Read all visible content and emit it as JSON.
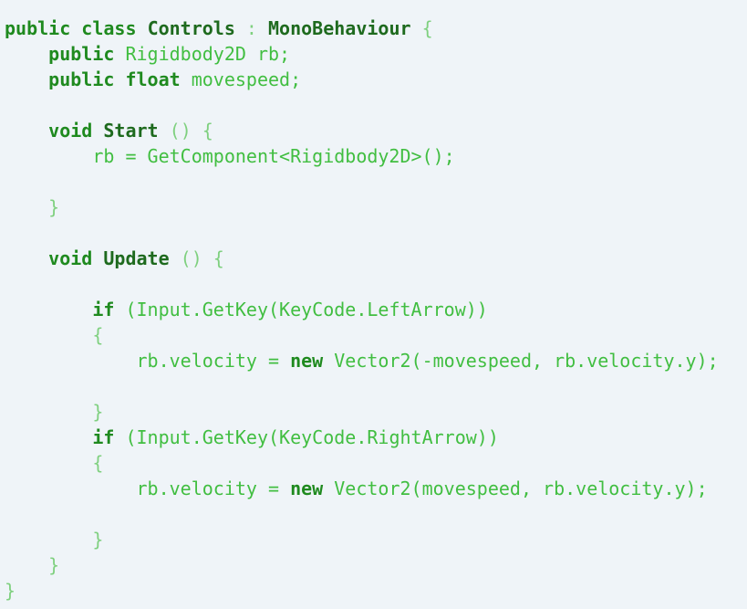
{
  "editor": {
    "language": "csharp",
    "colors": {
      "background": "#eff4f8",
      "keyword": "#1f8a1f",
      "identifier": "#41be41",
      "function_name": "#1e6a1e",
      "punctuation": "#7fd07f"
    },
    "lines": [
      [
        {
          "t": "public",
          "c": "kw"
        },
        {
          "t": " ",
          "c": "pl"
        },
        {
          "t": "class",
          "c": "kw"
        },
        {
          "t": " ",
          "c": "pl"
        },
        {
          "t": "Controls",
          "c": "fn"
        },
        {
          "t": " : ",
          "c": "op"
        },
        {
          "t": "MonoBehaviour",
          "c": "fn"
        },
        {
          "t": " {",
          "c": "op"
        }
      ],
      [
        {
          "t": "    ",
          "c": "pl"
        },
        {
          "t": "public",
          "c": "kw"
        },
        {
          "t": " Rigidbody2D rb;",
          "c": "pl"
        }
      ],
      [
        {
          "t": "    ",
          "c": "pl"
        },
        {
          "t": "public",
          "c": "kw"
        },
        {
          "t": " ",
          "c": "pl"
        },
        {
          "t": "float",
          "c": "kw"
        },
        {
          "t": " movespeed;",
          "c": "pl"
        }
      ],
      [],
      [
        {
          "t": "    ",
          "c": "pl"
        },
        {
          "t": "void",
          "c": "kw"
        },
        {
          "t": " ",
          "c": "pl"
        },
        {
          "t": "Start",
          "c": "fn"
        },
        {
          "t": " () {",
          "c": "op"
        }
      ],
      [
        {
          "t": "        rb = GetComponent<Rigidbody2D>();",
          "c": "pl"
        }
      ],
      [],
      [
        {
          "t": "    }",
          "c": "op"
        }
      ],
      [],
      [
        {
          "t": "    ",
          "c": "pl"
        },
        {
          "t": "void",
          "c": "kw"
        },
        {
          "t": " ",
          "c": "pl"
        },
        {
          "t": "Update",
          "c": "fn"
        },
        {
          "t": " () {",
          "c": "op"
        }
      ],
      [],
      [
        {
          "t": "        ",
          "c": "pl"
        },
        {
          "t": "if",
          "c": "kw"
        },
        {
          "t": " (Input.GetKey(KeyCode.LeftArrow))",
          "c": "pl"
        }
      ],
      [
        {
          "t": "        {",
          "c": "op"
        }
      ],
      [
        {
          "t": "            rb.velocity = ",
          "c": "pl"
        },
        {
          "t": "new",
          "c": "kw"
        },
        {
          "t": " Vector2(-movespeed, rb.velocity.y);",
          "c": "pl"
        }
      ],
      [],
      [
        {
          "t": "        }",
          "c": "op"
        }
      ],
      [
        {
          "t": "        ",
          "c": "pl"
        },
        {
          "t": "if",
          "c": "kw"
        },
        {
          "t": " (Input.GetKey(KeyCode.RightArrow))",
          "c": "pl"
        }
      ],
      [
        {
          "t": "        {",
          "c": "op"
        }
      ],
      [
        {
          "t": "            rb.velocity = ",
          "c": "pl"
        },
        {
          "t": "new",
          "c": "kw"
        },
        {
          "t": " Vector2(movespeed, rb.velocity.y);",
          "c": "pl"
        }
      ],
      [],
      [
        {
          "t": "        }",
          "c": "op"
        }
      ],
      [
        {
          "t": "    }",
          "c": "op"
        }
      ],
      [
        {
          "t": "}",
          "c": "op"
        }
      ]
    ]
  }
}
